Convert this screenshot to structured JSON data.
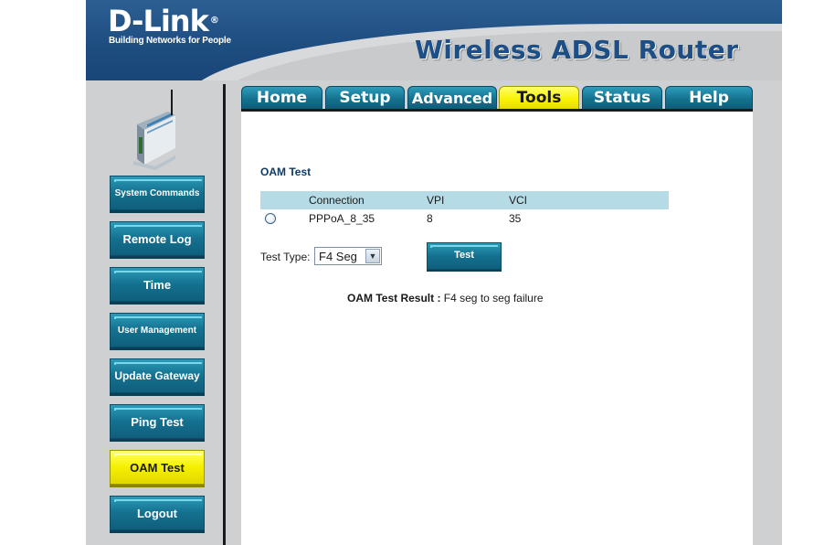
{
  "header": {
    "brand": "D-Link",
    "brand_mark": "®",
    "tagline": "Building Networks for People",
    "product": "Wireless ADSL Router"
  },
  "tabs": [
    {
      "label": "Home"
    },
    {
      "label": "Setup"
    },
    {
      "label": "Advanced"
    },
    {
      "label": "Tools",
      "active": true
    },
    {
      "label": "Status"
    },
    {
      "label": "Help"
    }
  ],
  "sidebar": {
    "device_icon": "router-device-icon",
    "items": [
      {
        "label": "System Commands"
      },
      {
        "label": "Remote Log"
      },
      {
        "label": "Time"
      },
      {
        "label": "User Management"
      },
      {
        "label": "Update Gateway"
      },
      {
        "label": "Ping Test"
      },
      {
        "label": "OAM Test",
        "active": true
      },
      {
        "label": "Logout"
      }
    ]
  },
  "main": {
    "section_title": "OAM Test",
    "table": {
      "headers": [
        "Connection",
        "VPI",
        "VCI"
      ],
      "rows": [
        {
          "connection": "PPPoA_8_35",
          "vpi": "8",
          "vci": "35",
          "selected": false
        }
      ]
    },
    "test_type": {
      "label": "Test Type:",
      "selected": "F4 Seg"
    },
    "test_button": "Test",
    "result": {
      "label": "OAM Test Result :",
      "value": "F4 seg to seg failure"
    }
  },
  "colors": {
    "header_blue": "#1d4c7f",
    "button_teal": "#14708f",
    "active_yellow": "#f5f000",
    "table_header": "#b5dbe6",
    "title_blue": "#0e3a66"
  }
}
